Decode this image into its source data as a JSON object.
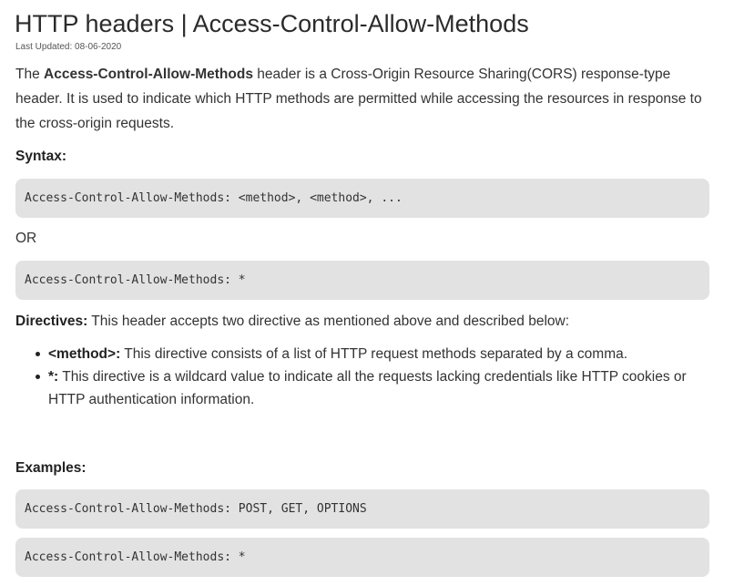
{
  "article": {
    "title": "HTTP headers | Access-Control-Allow-Methods",
    "last_updated": "Last Updated: 08-06-2020",
    "intro": {
      "prefix": "The ",
      "bold": "Access-Control-Allow-Methods",
      "suffix": " header is a  Cross-Origin Resource Sharing(CORS) response-type header. It is used to indicate which HTTP methods are permitted while accessing the resources in response to the cross-origin requests."
    },
    "syntax_label": "Syntax:",
    "syntax_code_1": "Access-Control-Allow-Methods: <method>, <method>, ...",
    "or_text": "OR",
    "syntax_code_2": "Access-Control-Allow-Methods: *",
    "directives": {
      "label": "Directives:",
      "text": "  This header accepts two directive as mentioned above and described below:"
    },
    "directive_items": [
      {
        "term": "<method>:",
        "text": " This directive consists of a list of HTTP request methods separated by a comma."
      },
      {
        "term": "*:",
        "text": " This directive is a wildcard value to indicate all the requests lacking credentials like HTTP cookies or HTTP authentication information."
      }
    ],
    "examples_label": "Examples:",
    "example_code_1": "Access-Control-Allow-Methods: POST, GET, OPTIONS",
    "example_code_2": "Access-Control-Allow-Methods: *"
  }
}
